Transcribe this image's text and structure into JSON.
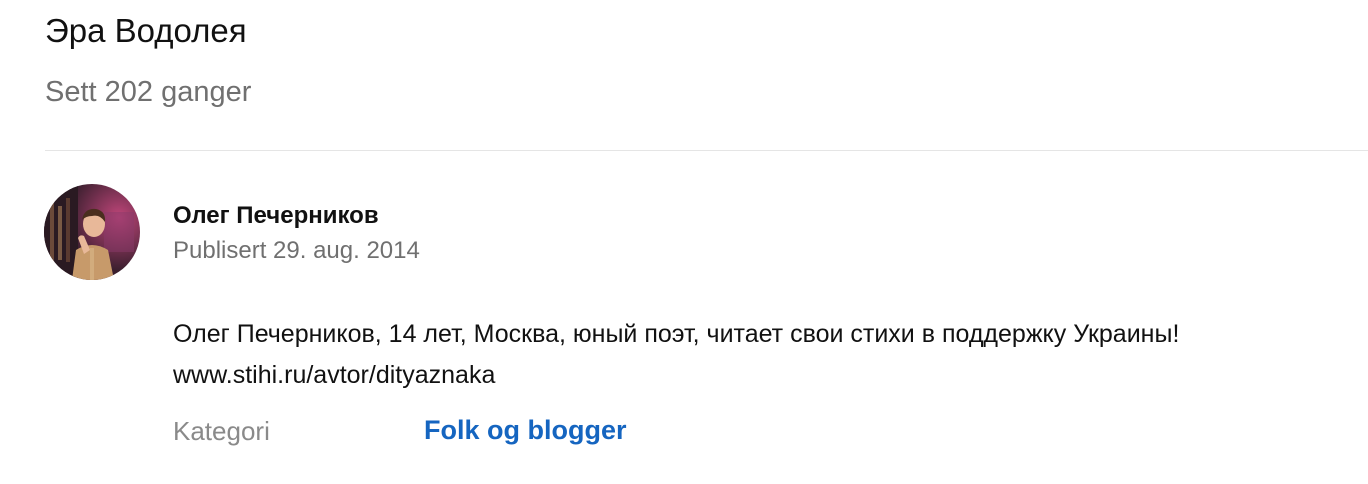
{
  "video": {
    "title": "Эра Водолея",
    "views": "Sett 202 ganger"
  },
  "channel": {
    "name": "Олег Печерников",
    "published": "Publisert 29. aug. 2014",
    "avatar_colors": {
      "background": "#3a1f2e",
      "glow": "#c0467a",
      "shirt": "#c79a6a",
      "face": "#e8b899",
      "hair": "#4a2e1e"
    }
  },
  "description": {
    "line1": "Олег Печерников, 14 лет, Москва, юный поэт, читает свои стихи в поддержку Украины!",
    "line2": "www.stihi.ru/avtor/dityaznaka"
  },
  "category": {
    "label": "Kategori",
    "value": "Folk og blogger",
    "link_color": "#1565c0"
  }
}
